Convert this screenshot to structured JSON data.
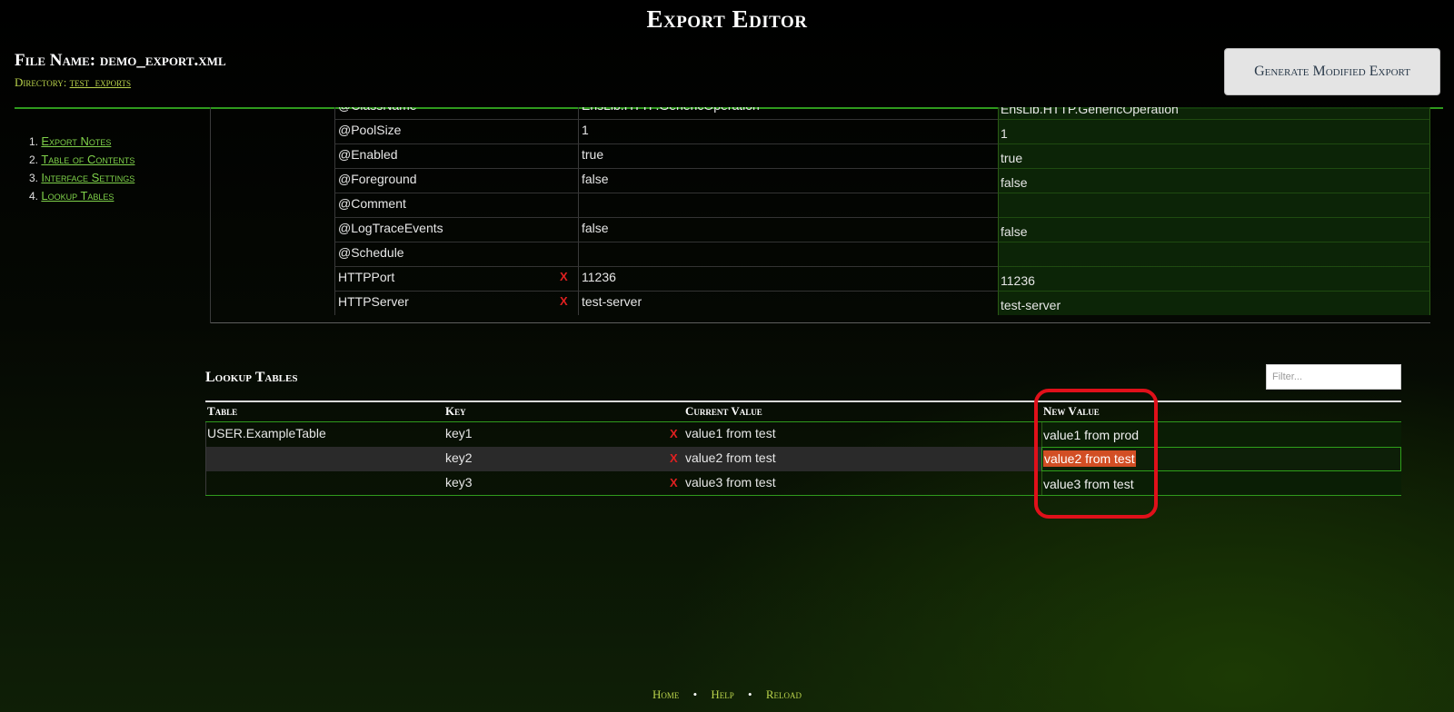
{
  "title": "Export Editor",
  "file": {
    "name_label": "File Name: demo_export.xml",
    "directory_label": "Directory:",
    "directory_value": "test_exports"
  },
  "actions": {
    "generate_label": "Generate Modified Export"
  },
  "toc": {
    "items": [
      {
        "num": "1.",
        "label": "Export Notes"
      },
      {
        "num": "2.",
        "label": "Table of Contents"
      },
      {
        "num": "3.",
        "label": "Interface Settings"
      },
      {
        "num": "4.",
        "label": "Lookup Tables"
      }
    ]
  },
  "settings": {
    "rows": [
      {
        "name": "@ClassName",
        "current": "EnsLib.HTTP.GenericOperation",
        "new": "EnsLib.HTTP.GenericOperation",
        "removable": false
      },
      {
        "name": "@PoolSize",
        "current": "1",
        "new": "1",
        "removable": false
      },
      {
        "name": "@Enabled",
        "current": "true",
        "new": "true",
        "removable": false
      },
      {
        "name": "@Foreground",
        "current": "false",
        "new": "false",
        "removable": false
      },
      {
        "name": "@Comment",
        "current": "",
        "new": "",
        "removable": false
      },
      {
        "name": "@LogTraceEvents",
        "current": "false",
        "new": "false",
        "removable": false
      },
      {
        "name": "@Schedule",
        "current": "",
        "new": "",
        "removable": false
      },
      {
        "name": "HTTPPort",
        "current": "11236",
        "new": "11236",
        "removable": true
      },
      {
        "name": "HTTPServer",
        "current": "test-server",
        "new": "test-server",
        "removable": true
      }
    ]
  },
  "lookup": {
    "title": "Lookup Tables",
    "filter_placeholder": "Filter...",
    "columns": {
      "table": "Table",
      "key": "Key",
      "current": "Current Value",
      "new": "New Value"
    },
    "rows": [
      {
        "table": "USER.ExampleTable",
        "key": "key1",
        "current": "value1 from test",
        "new": "value1 from prod"
      },
      {
        "table": "",
        "key": "key2",
        "current": "value2 from test",
        "new": "value2 from test"
      },
      {
        "table": "",
        "key": "key3",
        "current": "value3 from test",
        "new": "value3 from test"
      }
    ],
    "delete_glyph": "X"
  },
  "footer": {
    "links": [
      "Home",
      "Help",
      "Reload"
    ],
    "separator": "•"
  },
  "colors": {
    "accent_green": "#2f9a1d",
    "link_green": "#7fd14a",
    "delete_red": "#e02020",
    "highlight_red": "#e0101a",
    "selection": "#d24e24"
  }
}
